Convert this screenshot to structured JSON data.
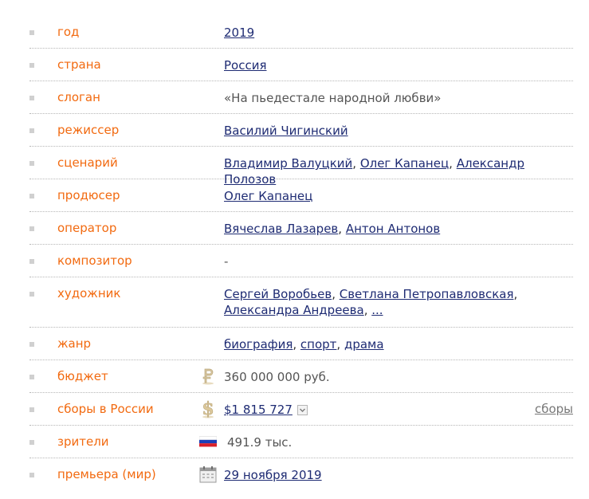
{
  "rows": [
    {
      "label": "год",
      "values": [
        "2019"
      ]
    },
    {
      "label": "страна",
      "values": [
        "Россия"
      ]
    },
    {
      "label": "слоган",
      "text": "«На пьедестале народной любви»"
    },
    {
      "label": "режиссер",
      "values": [
        "Василий Чигинский"
      ]
    },
    {
      "label": "сценарий",
      "values": [
        "Владимир Валуцкий",
        "Олег Капанец",
        "Александр Полозов"
      ]
    },
    {
      "label": "продюсер",
      "values": [
        "Олег Капанец"
      ]
    },
    {
      "label": "оператор",
      "values": [
        "Вячеслав Лазарев",
        "Антон Антонов"
      ]
    },
    {
      "label": "композитор",
      "text": "-"
    },
    {
      "label": "художник",
      "values": [
        "Сергей Воробьев",
        "Светлана Петропавловская",
        "Александра Андреева",
        "..."
      ]
    },
    {
      "label": "жанр",
      "values": [
        "биография",
        "спорт",
        "драма"
      ]
    },
    {
      "label": "бюджет",
      "text": "360 000 000 руб.",
      "icon": "ruble-icon"
    },
    {
      "label": "сборы в России",
      "values": [
        "$1 815 727"
      ],
      "icon": "dollar-icon",
      "right_link": "сборы"
    },
    {
      "label": "зрители",
      "text": "491.9 тыс.",
      "icon": "russia-flag-icon"
    },
    {
      "label": "премьера (мир)",
      "values": [
        "29 ноября 2019"
      ],
      "icon": "calendar-icon"
    }
  ],
  "colors": {
    "label": "#f26a10",
    "link": "#1e2b73",
    "bullet": "#d0d0d0",
    "divider": "#b7b7b7"
  }
}
